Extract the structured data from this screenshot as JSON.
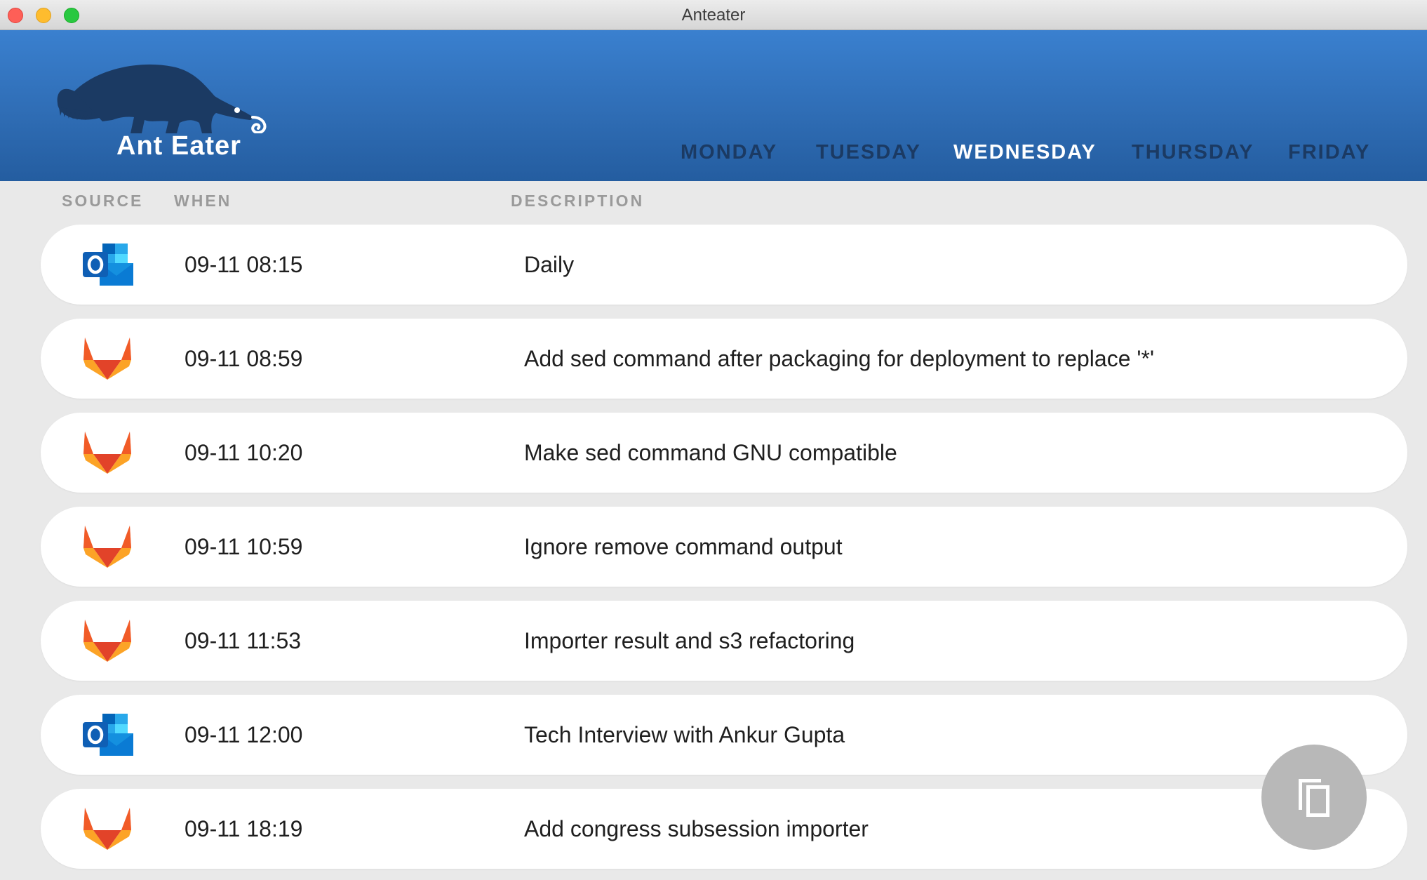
{
  "window": {
    "title": "Anteater"
  },
  "header": {
    "brand": "Ant Eater",
    "days": [
      {
        "label": "MONDAY",
        "active": false
      },
      {
        "label": "TUESDAY",
        "active": false
      },
      {
        "label": "WEDNESDAY",
        "active": true
      },
      {
        "label": "THURSDAY",
        "active": false
      },
      {
        "label": "FRIDAY",
        "active": false
      }
    ]
  },
  "columns": {
    "source": "SOURCE",
    "when": "WHEN",
    "description": "DESCRIPTION"
  },
  "rows": [
    {
      "source": "outlook-icon",
      "when": "09-11 08:15",
      "description": "Daily"
    },
    {
      "source": "gitlab-icon",
      "when": "09-11 08:59",
      "description": "Add sed command after packaging for deployment to replace '*'"
    },
    {
      "source": "gitlab-icon",
      "when": "09-11 10:20",
      "description": "Make sed command GNU compatible"
    },
    {
      "source": "gitlab-icon",
      "when": "09-11 10:59",
      "description": "Ignore remove command output"
    },
    {
      "source": "gitlab-icon",
      "when": "09-11 11:53",
      "description": "Importer result and s3 refactoring"
    },
    {
      "source": "outlook-icon",
      "when": "09-11 12:00",
      "description": "Tech Interview with Ankur Gupta"
    },
    {
      "source": "gitlab-icon",
      "when": "09-11 18:19",
      "description": "Add congress subsession importer"
    }
  ],
  "fab": {
    "icon": "copy-icon"
  },
  "colors": {
    "header_top": "#3a80cf",
    "header_bottom": "#245da0",
    "day_inactive": "#1b3a63",
    "day_active": "#ffffff",
    "background": "#e9e9e9"
  }
}
